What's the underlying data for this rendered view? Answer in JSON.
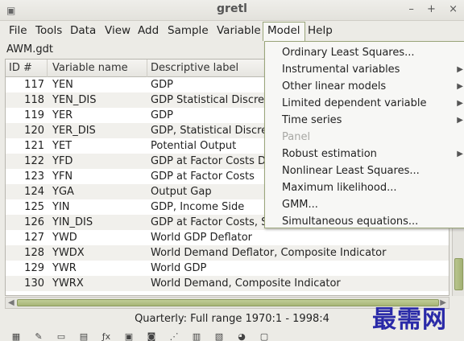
{
  "window": {
    "title": "gretl",
    "controls": [
      "–",
      "+",
      "×"
    ]
  },
  "menubar": [
    "File",
    "Tools",
    "Data",
    "View",
    "Add",
    "Sample",
    "Variable",
    "Model",
    "Help"
  ],
  "filename": "AWM.gdt",
  "table": {
    "headers": [
      "ID #",
      "Variable name",
      "Descriptive label"
    ],
    "rows": [
      {
        "id": "117",
        "name": "YEN",
        "label": "GDP"
      },
      {
        "id": "118",
        "name": "YEN_DIS",
        "label": "GDP Statistical Discrepancy"
      },
      {
        "id": "119",
        "name": "YER",
        "label": "GDP"
      },
      {
        "id": "120",
        "name": "YER_DIS",
        "label": "GDP, Statistical Discrepancy"
      },
      {
        "id": "121",
        "name": "YET",
        "label": "Potential Output"
      },
      {
        "id": "122",
        "name": "YFD",
        "label": "GDP at Factor Costs Deflator"
      },
      {
        "id": "123",
        "name": "YFN",
        "label": "GDP at Factor Costs"
      },
      {
        "id": "124",
        "name": "YGA",
        "label": "Output Gap"
      },
      {
        "id": "125",
        "name": "YIN",
        "label": "GDP, Income Side"
      },
      {
        "id": "126",
        "name": "YIN_DIS",
        "label": "GDP at Factor Costs, Statistical Discrepancy"
      },
      {
        "id": "127",
        "name": "YWD",
        "label": "World GDP Deflator"
      },
      {
        "id": "128",
        "name": "YWDX",
        "label": "World Demand Deflator, Composite Indicator"
      },
      {
        "id": "129",
        "name": "YWR",
        "label": "World GDP"
      },
      {
        "id": "130",
        "name": "YWRX",
        "label": "World Demand, Composite Indicator"
      }
    ]
  },
  "model_menu": [
    {
      "label": "Ordinary Least Squares...",
      "submenu": false,
      "disabled": false
    },
    {
      "label": "Instrumental variables",
      "submenu": true,
      "disabled": false
    },
    {
      "label": "Other linear models",
      "submenu": true,
      "disabled": false
    },
    {
      "label": "Limited dependent variable",
      "submenu": true,
      "disabled": false
    },
    {
      "label": "Time series",
      "submenu": true,
      "disabled": false
    },
    {
      "label": "Panel",
      "submenu": false,
      "disabled": true
    },
    {
      "label": "Robust estimation",
      "submenu": true,
      "disabled": false
    },
    {
      "label": "Nonlinear Least Squares...",
      "submenu": false,
      "disabled": false
    },
    {
      "label": "Maximum likelihood...",
      "submenu": false,
      "disabled": false
    },
    {
      "label": "GMM...",
      "submenu": false,
      "disabled": false
    },
    {
      "label": "Simultaneous equations...",
      "submenu": false,
      "disabled": false
    }
  ],
  "status": "Quarterly: Full range 1970:1 - 1998:4",
  "watermark": "最需网",
  "colors": {
    "menu_border": "#9aa57a",
    "scroll_thumb": "#a7b577",
    "watermark": "#2a2aa8"
  }
}
